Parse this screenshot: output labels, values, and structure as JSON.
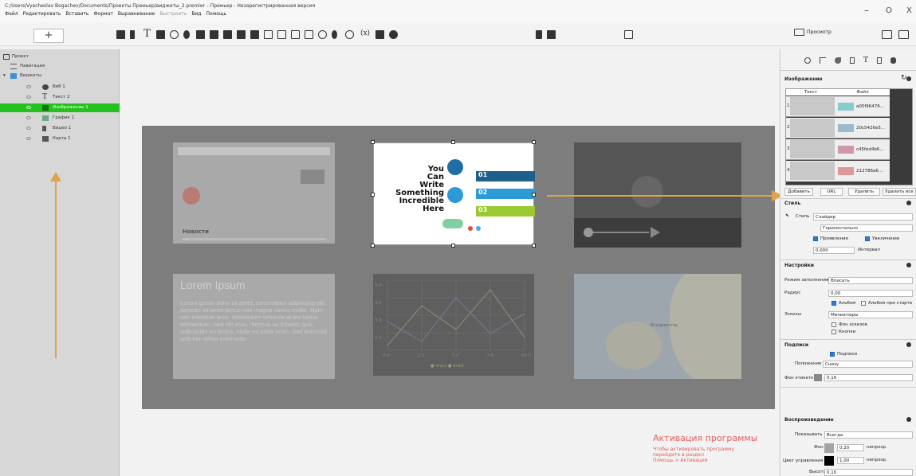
{
  "window": {
    "title": "C:/Users/Vyacheslav Bogachev/Documents/Проекты Премьер/виджеты_2.premier – Премьер - Незарегистрированная версия",
    "minimize": "–",
    "maximize": "O",
    "close": "X"
  },
  "menu": {
    "file": "Файл",
    "edit": "Редактировать",
    "insert": "Вставить",
    "format": "Формат",
    "align": "Выравнивание",
    "build": "Выстроить",
    "view": "Вид",
    "help": "Помощь"
  },
  "toolbar": {
    "add_label": "+",
    "preview_label": "Просмотр"
  },
  "project_tree": {
    "root": "Проект",
    "navigation": "Навигация",
    "widgets": "Виджеты",
    "items": [
      {
        "label": "Веб 1",
        "icon": "globe-icon"
      },
      {
        "label": "Текст 2",
        "icon": "text-icon"
      },
      {
        "label": "Изображение 1",
        "icon": "image-icon",
        "selected": true
      },
      {
        "label": "График 1",
        "icon": "chart-icon"
      },
      {
        "label": "Видео 1",
        "icon": "video-icon"
      },
      {
        "label": "Карта 1",
        "icon": "map-icon"
      }
    ]
  },
  "canvas": {
    "search_widget_title": "Новости",
    "lorem_title": "Lorem Ipsum",
    "lorem_text": "Lorem ipsum dolor sit amet, consectetur adipiscing elit. Aenean sit amet lectus non magna varius mollis. Nam non interdum arcu. Vestibulum vehicula at leo luctus elementum. Sed elit arcu, rhoncus ac lobortis quis, sollicitudin eu lectus. Nulla eu porta enim. Sed euismod velit non tellus commodo",
    "infographic": {
      "headline_lines": [
        "You",
        "Can",
        "Write",
        "Something",
        "Incredible",
        "Here"
      ],
      "steps": [
        "01",
        "02",
        "03"
      ]
    },
    "chart": {
      "y_ticks": [
        "5.0",
        "4.0",
        "3.0",
        "2.0",
        "1.0"
      ],
      "x_ticks": [
        "0.0",
        "2.5",
        "5.0",
        "7.5",
        "10.0"
      ],
      "legend": [
        "line1",
        "line2"
      ]
    },
    "map_label": "Владивосток"
  },
  "right_panel": {
    "image_section": "Изображение",
    "table_headers": [
      "Текст",
      "Файл"
    ],
    "table_rows": [
      {
        "num": "1",
        "file": "a05f96476..."
      },
      {
        "num": "2",
        "file": "20c5426e5..."
      },
      {
        "num": "3",
        "file": "c45fed4b6..."
      },
      {
        "num": "4",
        "file": "212786a6..."
      }
    ],
    "buttons": {
      "add": "Добавить",
      "url": "URL",
      "delete": "Удалить",
      "delete_all": "Удалить все"
    },
    "style_section": "Стиль",
    "style_label": "Стиль",
    "style_value": "Слайдер",
    "orientation_value": "Горизонтально",
    "fade_label": "Проявление",
    "zoom_label": "Увеличение",
    "interval_value": "0,000",
    "interval_label": "Интервал",
    "settings_section": "Настройки",
    "fill_mode_label": "Режим заполнения",
    "fill_mode_value": "Вписать",
    "radius_label": "Радиус",
    "radius_value": "0,00",
    "album_label": "Альбом",
    "album_start_label": "Альбом при старте",
    "thumbs_label": "Эскизы",
    "thumbs_value": "Миниатюры",
    "thumbs_bg_label": "Фон эскизов",
    "buttons_label": "Кнопки",
    "captions_section": "Подписи",
    "captions_check_label": "Подписи",
    "position_label": "Положение",
    "position_value": "Снизу",
    "label_bg_label": "Фон этикетки",
    "label_bg_value": "0,16",
    "playback_section": "Воспроизведение",
    "show_label": "Показывать",
    "show_value": "Всегда",
    "bg_label": "Фон",
    "bg_value": "0,20",
    "opacity_label": "непрозр.",
    "control_color_label": "Цвет управления",
    "control_value": "1,00",
    "height_label": "Высота",
    "height_value": "0,10"
  },
  "activation": {
    "title": "Активация программы",
    "line1": "Чтобы активировать программу",
    "line2": "перейдите в раздел",
    "line3": "Помощь > Активация"
  },
  "colors": {
    "selection_green": "#24c21d",
    "stage_gray": "#7d7d7d",
    "arrow_orange": "#e0a24a",
    "accent_blue": "#2a7fdc"
  }
}
